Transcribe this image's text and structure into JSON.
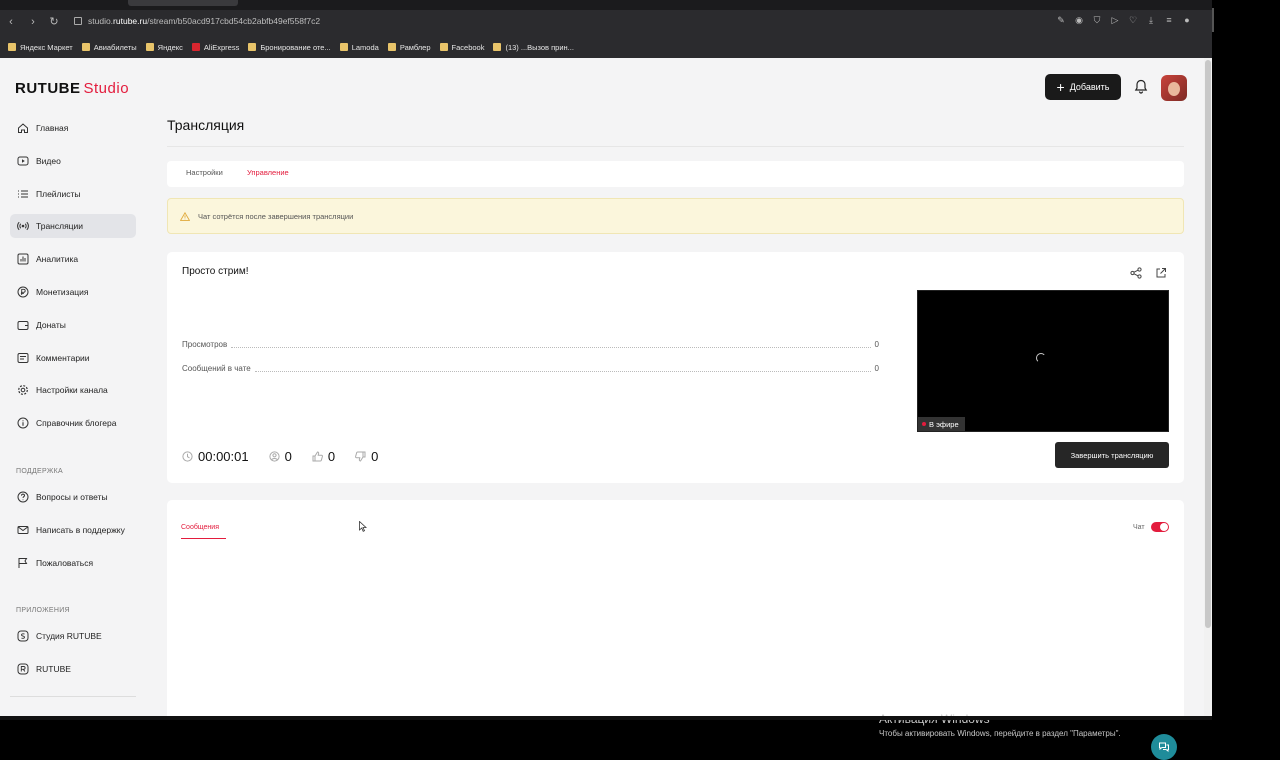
{
  "browser": {
    "url_prefix": "studio.",
    "url_host": "rutube.ru",
    "url_path": "/stream/b50acd917cbd54cb2abfb49ef558f7c2",
    "bookmarks": [
      {
        "label": "Яндекс Маркет"
      },
      {
        "label": "Авиабилеты"
      },
      {
        "label": "Яндекс"
      },
      {
        "label": "AliExpress"
      },
      {
        "label": "Бронирование оте..."
      },
      {
        "label": "Lamoda"
      },
      {
        "label": "Рамблер"
      },
      {
        "label": "Facebook"
      },
      {
        "label": "(13) ...Вызов прин..."
      }
    ]
  },
  "header": {
    "logo_main": "RUTUBE",
    "logo_sub": "Studio",
    "add_button": "Добавить"
  },
  "sidebar": {
    "items": [
      {
        "label": "Главная",
        "icon": "home-icon"
      },
      {
        "label": "Видео",
        "icon": "video-icon"
      },
      {
        "label": "Плейлисты",
        "icon": "playlist-icon"
      },
      {
        "label": "Трансляции",
        "icon": "broadcast-icon"
      },
      {
        "label": "Аналитика",
        "icon": "analytics-icon"
      },
      {
        "label": "Монетизация",
        "icon": "ruble-icon"
      },
      {
        "label": "Донаты",
        "icon": "wallet-icon"
      },
      {
        "label": "Комментарии",
        "icon": "comment-icon"
      },
      {
        "label": "Настройки канала",
        "icon": "gear-icon"
      },
      {
        "label": "Справочник блогера",
        "icon": "info-icon"
      }
    ],
    "support_heading": "ПОДДЕРЖКА",
    "support_items": [
      {
        "label": "Вопросы и ответы",
        "icon": "question-icon"
      },
      {
        "label": "Написать в поддержку",
        "icon": "mail-icon"
      },
      {
        "label": "Пожаловаться",
        "icon": "flag-icon"
      }
    ],
    "apps_heading": "ПРИЛОЖЕНИЯ",
    "apps_items": [
      {
        "label": "Студия RUTUBE",
        "icon": "studio-app-icon"
      },
      {
        "label": "RUTUBE",
        "icon": "rutube-app-icon"
      }
    ]
  },
  "main": {
    "title": "Трансляция",
    "tabs": [
      {
        "label": "Настройки"
      },
      {
        "label": "Управление",
        "active": true
      }
    ],
    "warning": "Чат сотрётся после завершения трансляции",
    "stream": {
      "name": "Просто стрим!",
      "stats": [
        {
          "label": "Просмотров",
          "value": "0"
        },
        {
          "label": "Сообщений в чате",
          "value": "0"
        }
      ],
      "timer": "00:00:01",
      "viewers": "0",
      "likes": "0",
      "dislikes": "0",
      "on_air": "В эфире",
      "end_button": "Завершить трансляцию"
    },
    "chat": {
      "tab": "Сообщения",
      "toggle_label": "Чат",
      "toggle_on": true
    }
  },
  "windows": {
    "activation_title": "Активация Windows",
    "activation_sub": "Чтобы активировать Windows, перейдите в раздел \"Параметры\"."
  },
  "colors": {
    "accent": "#e31c3d",
    "dark_button": "#1a1a1a",
    "warning_bg": "#fbf6dc",
    "help_fab": "#1f8c9a"
  }
}
